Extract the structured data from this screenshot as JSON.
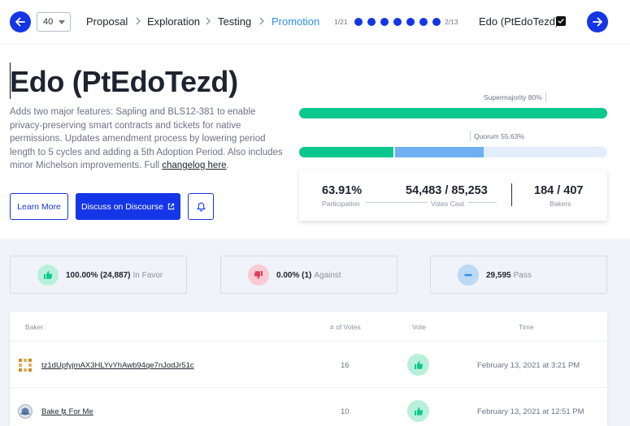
{
  "header": {
    "period_number": "40",
    "steps": [
      {
        "label": "Proposal",
        "active": false
      },
      {
        "label": "Exploration",
        "active": false
      },
      {
        "label": "Testing",
        "active": false
      },
      {
        "label": "Promotion",
        "active": true
      }
    ],
    "page_left": "1/21",
    "page_right": "2/13",
    "proposal_name": "Edo (PtEdoTezd)",
    "colors": {
      "primary": "#1436e6",
      "active_step": "#2e8ee6"
    }
  },
  "proposal": {
    "title": "Edo (PtEdoTezd)",
    "description": "Adds two major features: Sapling and BLS12-381 to enable privacy-preserving smart contracts and tickets for native permissions. Updates amendment process by lowering period length to 5 cycles and adding a 5th Adoption Period. Also includes minor Michelson improvements. Full ",
    "changelog_link": "changelog here",
    "description_end": ".",
    "learn_more": "Learn More",
    "discuss": "Discuss on Discourse"
  },
  "progress": {
    "supermajority_label": "Supermajority 80%",
    "supermajority_fill_percent": 99.91,
    "quorum_label": "Quorum 55.63%",
    "quorum_threshold_percent": 55.63,
    "participation_fill_percent": 63.91,
    "colors": {
      "green": "#0cc88e",
      "blue": "#6fb0f2",
      "track": "#e3edfb"
    }
  },
  "stats": {
    "participation": {
      "value": "63.91%",
      "label": "Participation"
    },
    "votes_cast": {
      "value": "54,483 / 85,253",
      "label": "Votes Cast"
    },
    "bakers": {
      "value": "184 / 407",
      "label": "Bakers"
    }
  },
  "summary": [
    {
      "value": "100.00% (24,887)",
      "label": "In Favor",
      "icon": "thumbs-up-icon",
      "color": "#0cc88e",
      "bg": "#b9f0dc"
    },
    {
      "value": "0.00% (1)",
      "label": "Against",
      "icon": "thumbs-down-icon",
      "color": "#e63a5a",
      "bg": "#fbcbd3"
    },
    {
      "value": "29,595",
      "label": "Pass",
      "icon": "minus-icon",
      "color": "#2e8ee6",
      "bg": "#bcd9f6"
    }
  ],
  "table": {
    "headers": {
      "baker": "Baker",
      "votes": "# of Votes",
      "vote": "Vote",
      "time": "Time"
    },
    "rows": [
      {
        "baker": "tz1dUpfyjmAX3HLYvYhAwb94qe7nJodJr51c",
        "votes": "16",
        "vote": "thumbs-up-icon",
        "time": "February 13, 2021 at 3:21 PM"
      },
      {
        "baker": "Bake ꜩ For Me",
        "votes": "10",
        "vote": "thumbs-up-icon",
        "time": "February 13, 2021 at 12:51 PM"
      }
    ]
  }
}
